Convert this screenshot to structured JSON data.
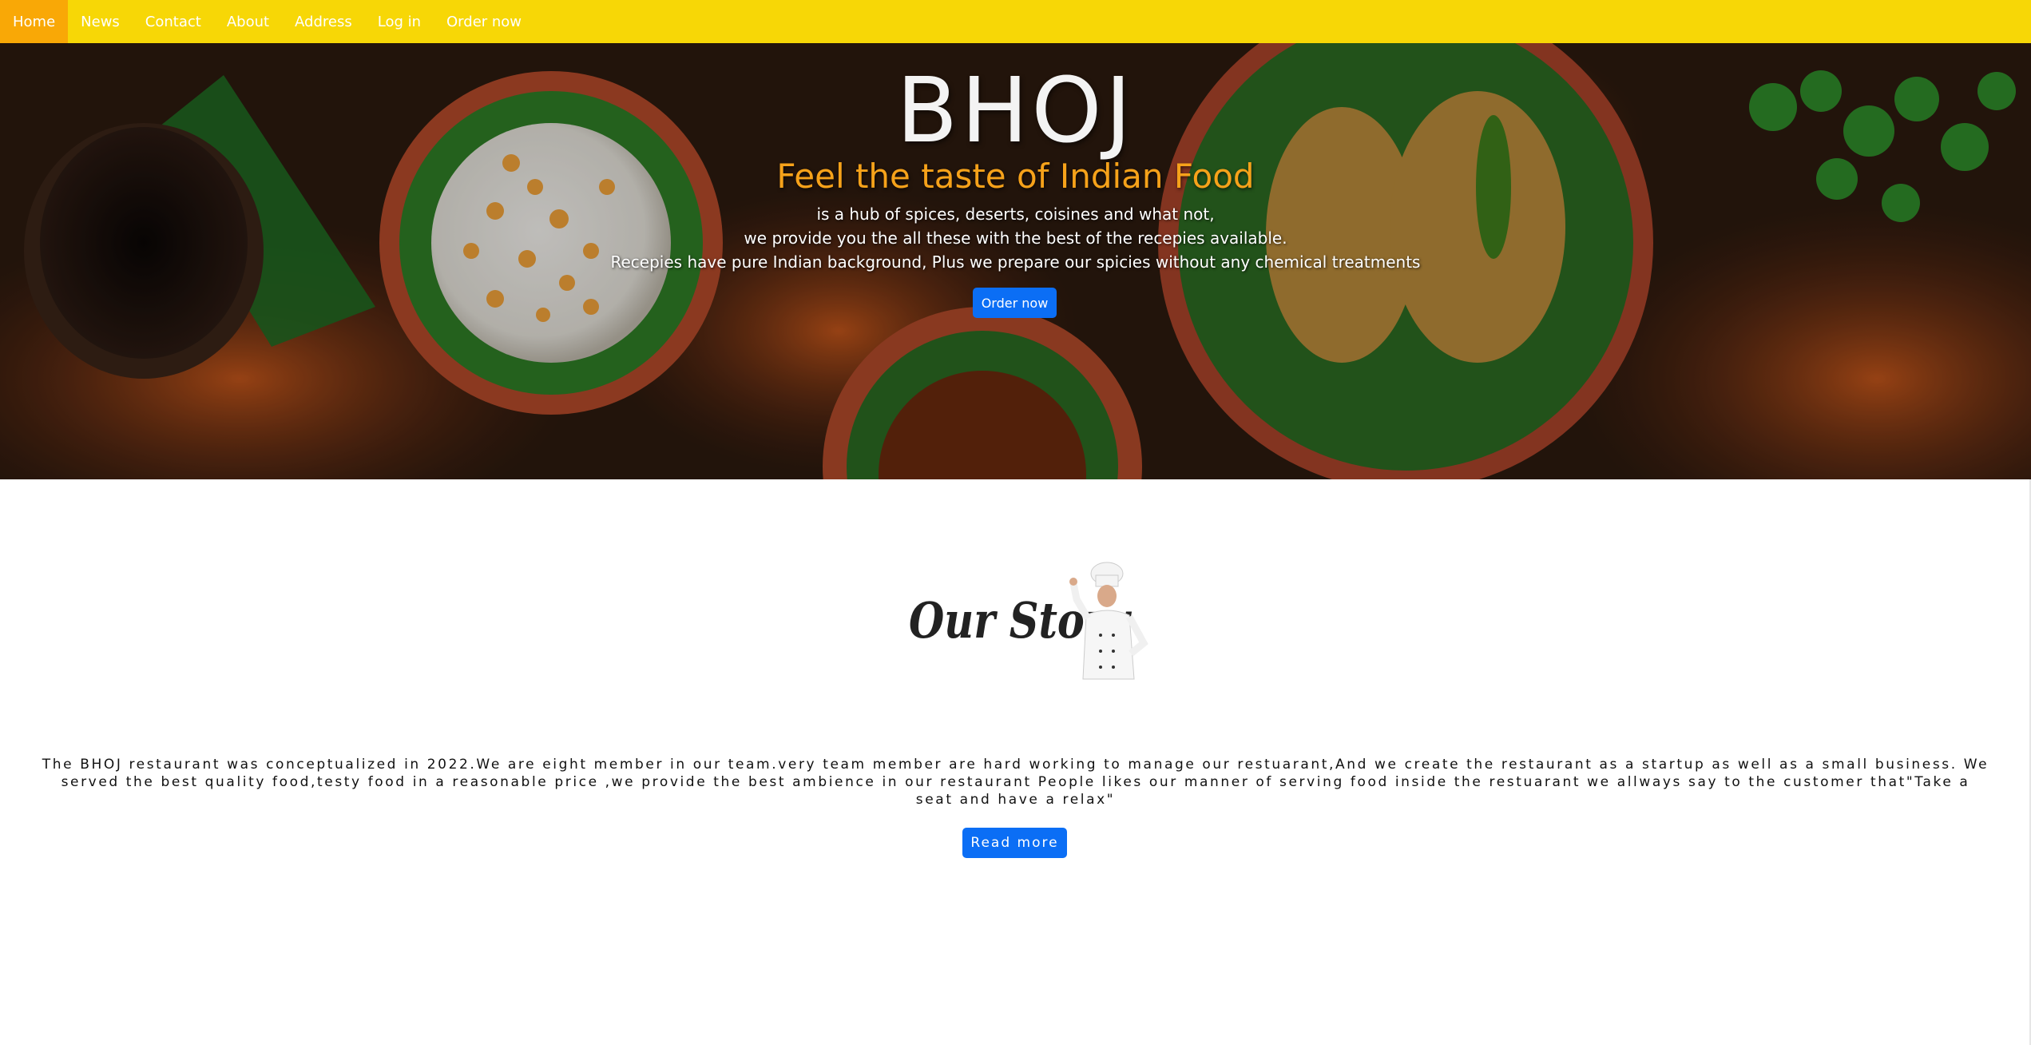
{
  "nav": {
    "items": [
      {
        "label": "Home",
        "active": true
      },
      {
        "label": "News"
      },
      {
        "label": "Contact"
      },
      {
        "label": "About"
      },
      {
        "label": "Address"
      },
      {
        "label": "Log in"
      },
      {
        "label": "Order now"
      }
    ]
  },
  "hero": {
    "title": "BHOJ",
    "subtitle": "Feel the taste of Indian Food",
    "lines": [
      "is a hub of spices, deserts, coisines and what not,",
      "we provide you the all these with the best of the recepies available.",
      "Recepies have pure Indian background, Plus we prepare our spicies without any chemical treatments"
    ],
    "button": "Order now"
  },
  "story": {
    "heading": "Our Story",
    "text": "The BHOJ restaurant was conceptualized in 2022.We are eight member in our team.very team member are hard working to manage our restuarant,And we create the restaurant as a startup as well as a small business. We served the best quality food,testy food in a reasonable price ,we provide the best ambience in our restaurant People likes our manner of serving food inside the restuarant we allways say to the customer that\"Take a seat and have a relax\"",
    "button": "Read more"
  },
  "colors": {
    "navbar": "#f7d706",
    "nav_active": "#f9a806",
    "button": "#0b6ef5",
    "subtitle": "#f6a21a"
  }
}
